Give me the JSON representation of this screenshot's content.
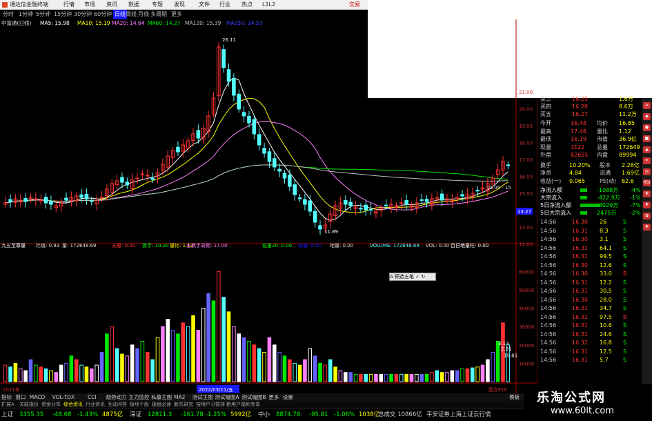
{
  "window": {
    "title": "通达信金融终端"
  },
  "menu": [
    "行情",
    "市场",
    "资讯",
    "数据",
    "专题",
    "发现",
    "文件",
    "行业",
    "热点",
    "L1L2"
  ],
  "trade_label": "交易",
  "periods": [
    "分时",
    "1分钟",
    "5分钟",
    "15分钟",
    "30分钟",
    "60分钟",
    "日线",
    "周线",
    "月线",
    "多周期",
    "更多"
  ],
  "ma_line": {
    "stock": "中富通(日线)",
    "ma5": "MA5: 15.98",
    "ma10": "MA10: 15.19",
    "ma20": "MA20: 14.64",
    "ma60": "MA60: 14.27",
    "ma120": "MA120: 15.39",
    "extra": "MA250: 14.53"
  },
  "annotations": {
    "high": "26.11",
    "low": "11.89",
    "last_box": "13.27",
    "small_low": "15.06 - 15"
  },
  "price_axis": [
    "21.00",
    "20.00",
    "19.00",
    "18.00",
    "17.00",
    "16.00",
    "15.00",
    "14.00",
    "13.00",
    "12.00"
  ],
  "vol_axis": [
    "60000",
    "50000",
    "40000",
    "30000",
    "20000",
    "10000"
  ],
  "vol_line": {
    "name": "九五至尊量",
    "ratio": "比值: 0.93",
    "qty": "量: 172648.69",
    "a": "无量: 0.00",
    "b": "换手: 10.20",
    "c": "量比: 1.12",
    "d": "全换手周期: 17.00",
    "e": "低量20: 0.00",
    "f": "倍量: 0.00",
    "g": "地量: 0.00",
    "h": "VOLUME: 172648.69",
    "i": "VOL: 0.00",
    "j": "百日地量柱: 0.00"
  },
  "vol_tags": {
    "t1": "3.13",
    "t2": "2.91",
    "t3": "15.65"
  },
  "date_axis": {
    "y2021": "2021年",
    "cursor": "2022/03/11/五",
    "col": "图文F10"
  },
  "quote": {
    "asks": [
      {
        "label": "卖三",
        "price": "16.29",
        "vol": "1.6万"
      },
      {
        "label": "买四",
        "price": "16.28",
        "vol": "8.6万"
      },
      {
        "label": "买五",
        "price": "16.27",
        "vol": "11.2万"
      }
    ],
    "stats": [
      {
        "l": "今开",
        "v": "16.48",
        "l2": "均价",
        "v2": "16.85"
      },
      {
        "l": "最高",
        "v": "17.48",
        "l2": "量比",
        "v2": "1.12"
      },
      {
        "l": "最低",
        "v": "16.19",
        "l2": "市值",
        "v2": "36.9亿"
      },
      {
        "l": "现量",
        "v": "3122",
        "l2": "总量",
        "v2": "172649"
      },
      {
        "l": "外盘",
        "v": "82655",
        "l2": "内盘",
        "v2": "89994"
      }
    ],
    "stats2": [
      {
        "l": "换手",
        "v": "10.20%",
        "l2": "股本",
        "v2": "2.26亿"
      },
      {
        "l": "净资",
        "v": "4.84",
        "l2": "流通",
        "v2": "1.69亿"
      },
      {
        "l": "收益(一)",
        "v": "0.065",
        "l2": "PE(动)",
        "v2": "62.6"
      }
    ],
    "flows": [
      {
        "l": "净流入额",
        "v": "-1088万",
        "p": "-4%"
      },
      {
        "l": "大宗流入",
        "v": "-422.9万",
        "p": "-1%"
      },
      {
        "l": "5日净流入额",
        "v": "-8029万",
        "p": "-7%"
      },
      {
        "l": "5日大宗流入",
        "v": "2475万",
        "p": "-2%"
      }
    ],
    "ticks": [
      {
        "t": "14:56",
        "p": "16.30",
        "v": "26",
        "s": "S"
      },
      {
        "t": "14:56",
        "p": "16.31",
        "v": "8.3",
        "s": "S"
      },
      {
        "t": "14:56",
        "p": "16.30",
        "v": "3.1",
        "s": "S"
      },
      {
        "t": "14:56",
        "p": "16.31",
        "v": "64.1",
        "s": "S"
      },
      {
        "t": "14:56",
        "p": "16.31",
        "v": "99.5",
        "s": "S"
      },
      {
        "t": "14:56",
        "p": "16.30",
        "v": "12.6",
        "s": "S"
      },
      {
        "t": "14:56",
        "p": "16.30",
        "v": "33.0",
        "s": "B"
      },
      {
        "t": "14:56",
        "p": "16.31",
        "v": "12.2",
        "s": "S"
      },
      {
        "t": "14:56",
        "p": "16.31",
        "v": "30.5",
        "s": "S"
      },
      {
        "t": "14:56",
        "p": "16.30",
        "v": "28.0",
        "s": "S"
      },
      {
        "t": "14:56",
        "p": "16.31",
        "v": "34.7",
        "s": "S"
      },
      {
        "t": "14:56",
        "p": "16.32",
        "v": "97.5",
        "s": "B"
      },
      {
        "t": "14:56",
        "p": "16.31",
        "v": "10.6",
        "s": "S"
      },
      {
        "t": "14:56",
        "p": "16.31",
        "v": "24.6",
        "s": "S"
      },
      {
        "t": "14:56",
        "p": "16.32",
        "v": "16.8",
        "s": "S"
      },
      {
        "t": "14:56",
        "p": "16.31",
        "v": "12.5",
        "s": "S"
      },
      {
        "t": "14:56",
        "p": "16.31",
        "v": "5.7",
        "s": "S"
      }
    ]
  },
  "tabs": [
    "指标",
    "窗口",
    "MACD",
    "VOL-TDX",
    "CCI",
    "趋势动力",
    "主力监控",
    "私募主图",
    "MA2",
    "测试主图",
    "测试幅图A",
    "测试幅图B",
    "更多",
    "设置"
  ],
  "tabs_right": "模板",
  "tabs2": [
    "扩展A",
    "关联报价",
    "资金分布",
    "综合资讯",
    "行业资讯",
    "互动问答",
    "板块个股",
    "操盘必读",
    "股东研究",
    "按用户习惯排",
    "新用户福利专享"
  ],
  "status": [
    {
      "l": "上证",
      "v": "3355.35",
      "c": "-48.68",
      "p": "-1.43%",
      "a": "4875亿"
    },
    {
      "l": "深证",
      "v": "12811.3",
      "c": "-161.78",
      "p": "-1.25%",
      "a": "5992亿"
    },
    {
      "l": "中小",
      "v": "8874.78",
      "c": "-95.81",
      "p": "-1.06%",
      "a": "1038亿"
    }
  ],
  "status_right": "总成交 10866亿",
  "status_right2": "平安证券上海上证云行情",
  "tooltip": "A 预选五笔 ✓ ↻",
  "watermark": {
    "line1": "乐淘公式网",
    "line2": "www.60lt.com"
  },
  "colors": {
    "up": "#ff3232",
    "down": "#54ffff",
    "ma5": "#ffffff",
    "ma10": "#ffff00",
    "ma20": "#ff80ff",
    "ma60": "#00e600",
    "ma120": "#bbbbbb",
    "accent": "#1a1aff"
  },
  "chart_data": {
    "type": "candlestick",
    "note_units": "price in CNY, volume in lots",
    "closes": [
      14.2,
      14.3,
      14.5,
      14.4,
      14.3,
      14.6,
      14.5,
      14.4,
      14.2,
      14.1,
      14.0,
      14.3,
      14.4,
      14.6,
      14.7,
      14.6,
      14.5,
      14.3,
      14.4,
      14.6,
      15.2,
      15.6,
      15.8,
      15.7,
      15.5,
      15.9,
      16.0,
      16.3,
      16.2,
      15.9,
      16.4,
      17.0,
      17.6,
      18.0,
      17.9,
      18.4,
      18.7,
      19.2,
      18.9,
      19.6,
      20.5,
      21.8,
      25.5,
      24.0,
      23.0,
      22.0,
      21.0,
      20.5,
      20.0,
      19.2,
      18.4,
      17.8,
      17.2,
      16.8,
      16.5,
      16.0,
      15.4,
      14.8,
      14.5,
      14.1,
      13.6,
      12.8,
      12.3,
      12.6,
      13.4,
      14.0,
      14.2,
      14.1,
      14.0,
      13.9,
      13.8,
      13.7,
      13.7,
      13.6,
      13.8,
      14.0,
      14.1,
      14.0,
      14.2,
      14.1,
      14.0,
      14.2,
      14.4,
      14.3,
      14.5,
      14.6,
      14.4,
      14.5,
      14.4,
      14.6,
      14.7,
      14.8,
      14.9,
      15.1,
      15.3,
      15.6,
      16.0,
      16.6,
      17.2,
      16.9
    ],
    "volumes": [
      9000,
      8000,
      10000,
      7000,
      6000,
      12000,
      9000,
      8000,
      7000,
      6000,
      5000,
      9000,
      10000,
      14000,
      12000,
      9000,
      8000,
      7000,
      9000,
      16000,
      26000,
      30000,
      18000,
      15000,
      14000,
      20000,
      18000,
      22000,
      16000,
      12000,
      24000,
      30000,
      34000,
      28000,
      26000,
      32000,
      30000,
      36000,
      28000,
      40000,
      48000,
      44000,
      60000,
      46000,
      38000,
      30000,
      26000,
      24000,
      22000,
      20000,
      18000,
      16000,
      24000,
      20000,
      16000,
      14000,
      12000,
      10000,
      9000,
      12000,
      18000,
      14000,
      10000,
      9000,
      12000,
      8000,
      6000,
      5000,
      5000,
      4000,
      4000,
      4000,
      4000,
      4000,
      4000,
      4000,
      4000,
      4000,
      4000,
      4000,
      4000,
      4000,
      4000,
      4000,
      5000,
      6000,
      5000,
      5000,
      6000,
      6000,
      7000,
      7000,
      7500,
      8000,
      9000,
      12000,
      16000,
      22000,
      32000,
      20000
    ]
  }
}
